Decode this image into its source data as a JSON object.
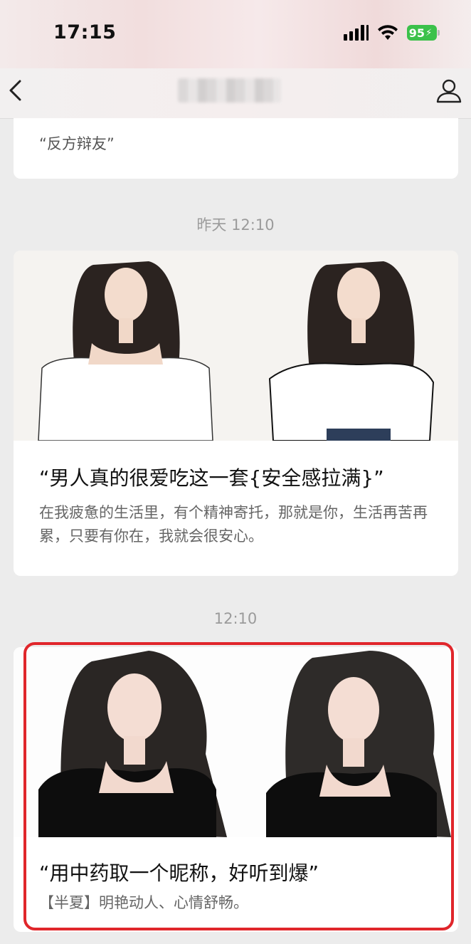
{
  "status_bar": {
    "time": "17:15",
    "battery": "95"
  },
  "header": {
    "back_icon": "chevron-left-icon",
    "profile_icon": "person-icon"
  },
  "messages": [
    {
      "title": "“反方辩友”"
    },
    {
      "timestamp": "昨天 12:10",
      "title": "“男人真的很爱吃这一套{安全感拉满}”",
      "description": "在我疲惫的生活里，有个精神寄托，那就是你，生活再苦再累，只要有你在，我就会很安心。"
    },
    {
      "timestamp": "12:10",
      "title": "“用中药取一个昵称，好听到爆”",
      "description": "【半夏】明艳动人、心情舒畅。"
    }
  ],
  "colors": {
    "highlight": "#e0262b",
    "battery": "#3bc14a"
  }
}
